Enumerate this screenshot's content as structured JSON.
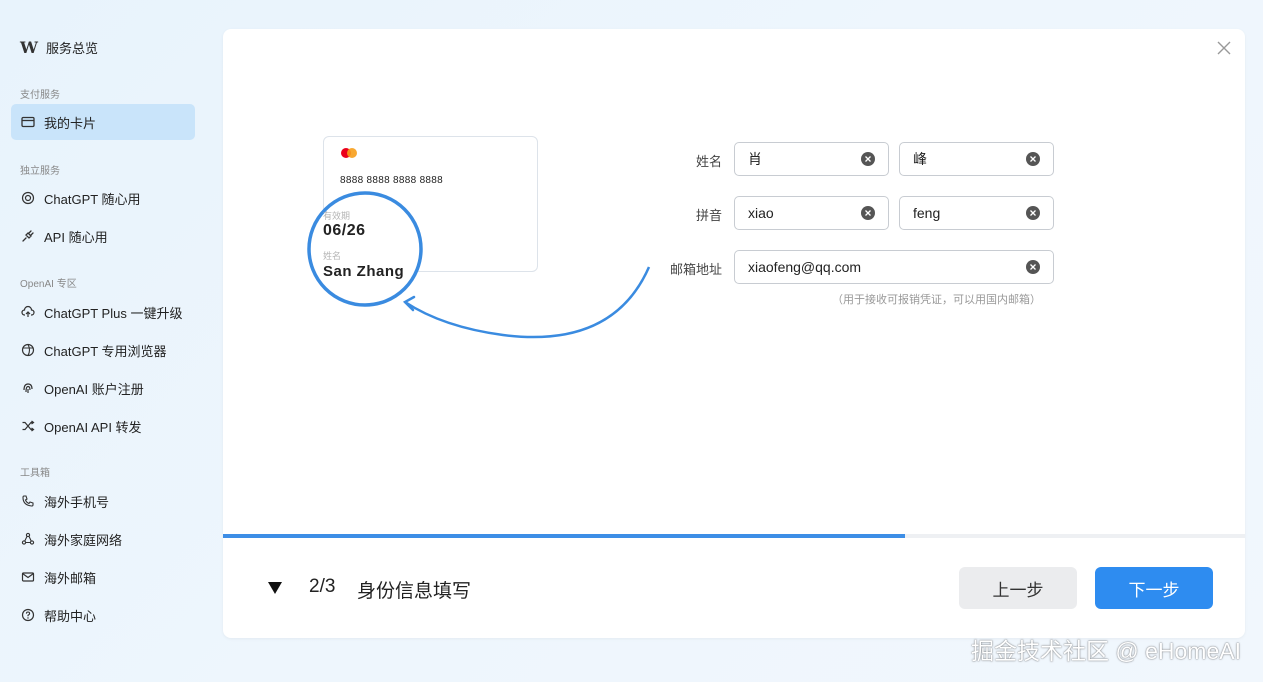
{
  "sidebar": {
    "brand": {
      "logo": "W",
      "label": "服务总览"
    },
    "sections": {
      "payment": "支付服务",
      "standalone": "独立服务",
      "openai": "OpenAI 专区",
      "tools": "工具箱"
    },
    "items": {
      "my_cards": "我的卡片",
      "chatgpt_payg": "ChatGPT 随心用",
      "api_payg": "API 随心用",
      "chatgpt_plus": "ChatGPT Plus 一键升级",
      "chatgpt_browser": "ChatGPT 专用浏览器",
      "openai_register": "OpenAI 账户注册",
      "openai_api_forward": "OpenAI API 转发",
      "overseas_phone": "海外手机号",
      "overseas_network": "海外家庭网络",
      "overseas_email": "海外邮箱",
      "help": "帮助中心"
    }
  },
  "card_preview": {
    "number": "8888 8888 8888 8888",
    "expiry_label": "有效期",
    "expiry": "06/26",
    "name_label": "姓名",
    "name": "San Zhang"
  },
  "form": {
    "name_label": "姓名",
    "last_name": "肖",
    "first_name": "峰",
    "pinyin_label": "拼音",
    "pinyin_last": "xiao",
    "pinyin_first": "feng",
    "email_label": "邮箱地址",
    "email": "xiaofeng@qq.com",
    "email_hint": "（用于接收可报销凭证，可以用国内邮箱）"
  },
  "progress": {
    "fraction": 0.667
  },
  "footer": {
    "step_count": "2/3",
    "step_title": "身份信息填写",
    "prev_label": "上一步",
    "next_label": "下一步"
  },
  "colors": {
    "accent": "#2e8cf0",
    "active_nav": "#c9e4fa"
  },
  "watermark": "掘金技术社区 @ eHomeAI"
}
